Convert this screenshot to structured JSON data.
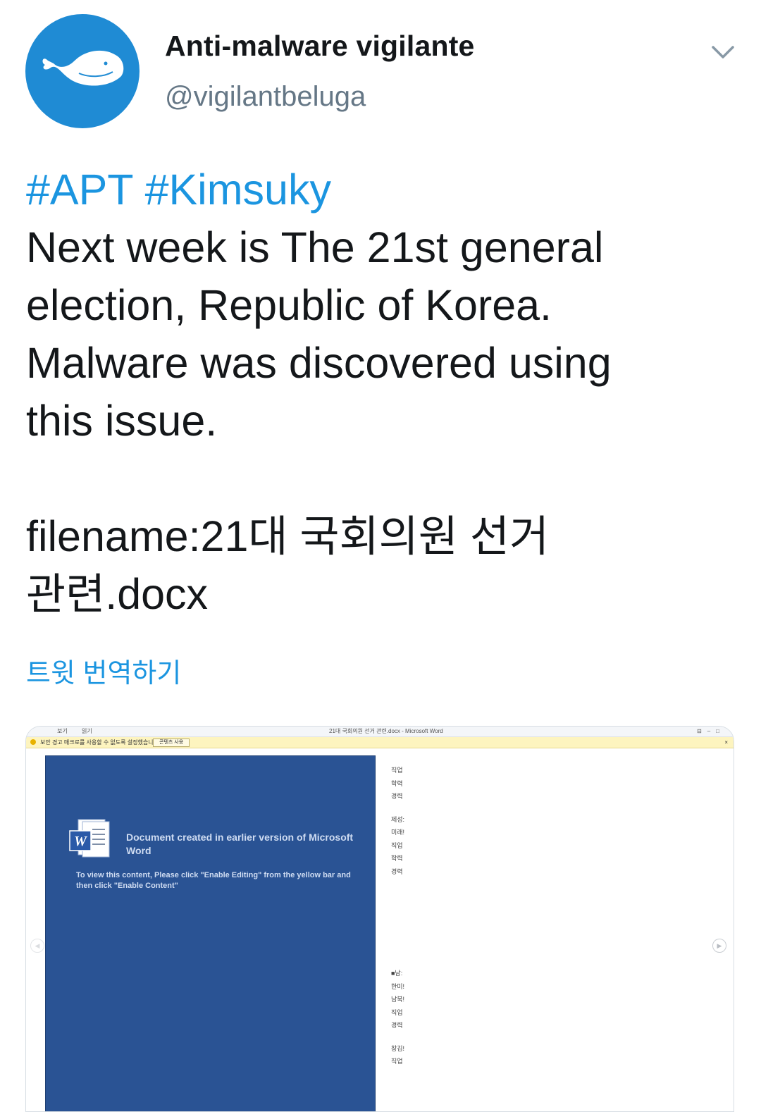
{
  "header": {
    "display_name": "Anti-malware vigilante",
    "handle": "@vigilantbeluga",
    "avatar_icon": "beluga-whale-icon",
    "menu_icon": "chevron-down-icon",
    "avatar_color": "#1f8bd4"
  },
  "tweet": {
    "hashtags": [
      "#APT",
      "#Kimsuky"
    ],
    "lines": [
      "Next week is The 21st general",
      "election, Republic of Korea.",
      "Malware was discovered using",
      "this issue."
    ],
    "filename_lines": [
      "filename:21대 국회의원 선거",
      "관련.docx"
    ],
    "translate_label": "트윗 번역하기",
    "link_color": "#1b95e0"
  },
  "media": {
    "window_title": "21대 국회의원 선거 관련.docx - Microsoft Word",
    "ribbon_tabs": [
      "보기",
      "읽기"
    ],
    "security_message": "보안 경고  매크로를 사용할 수 없도록 설정했습니다.",
    "enable_content_button": "콘텐츠 사용",
    "doc_title": "Document created in earlier version of Microsoft Word",
    "doc_instructions": "To view this content, Please click \"Enable Editing\" from the yellow bar and then click \"Enable Content\"",
    "side_blocks": [
      [
        "직업",
        "학력",
        "경력"
      ],
      [
        "제성:",
        "미래!",
        "직업",
        "학력",
        "경력"
      ],
      [
        "■남:",
        "한미!",
        "남북!",
        "직업",
        "경력"
      ],
      [
        "창김!",
        "직업"
      ]
    ]
  }
}
